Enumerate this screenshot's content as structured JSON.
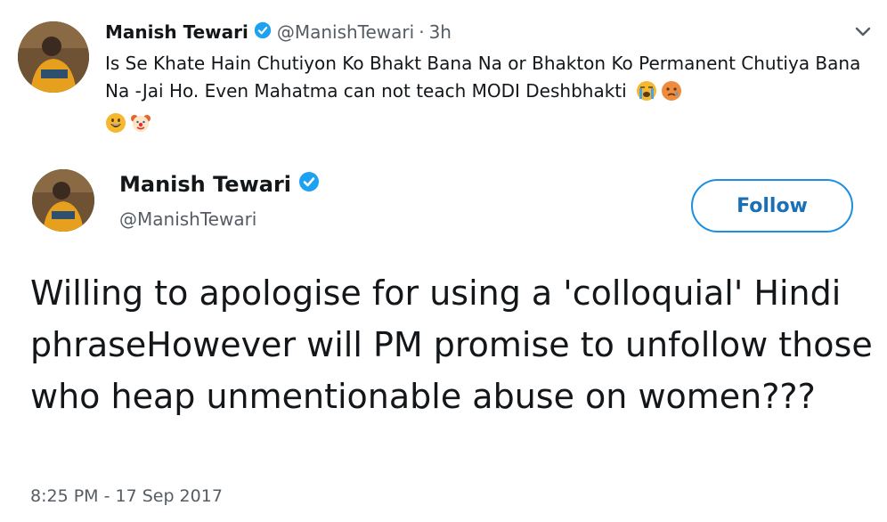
{
  "tweet1": {
    "name": "Manish Tewari",
    "handle": "@ManishTewari",
    "separator": "·",
    "time": "3h",
    "text": "Is Se Khate Hain Chutiyon Ko Bhakt Bana Na or Bhakton Ko Permanent Chutiya Bana Na -Jai Ho. Even Mahatma can not teach MODI Deshbhakti",
    "emojis": [
      "loudly-crying-face",
      "crying-face",
      "grinning-face",
      "clown-face"
    ]
  },
  "tweet2": {
    "name": "Manish Tewari",
    "handle": "@ManishTewari",
    "follow_label": "Follow",
    "text": "Willing to apologise for using a 'colloquial' Hindi phraseHowever will PM promise to unfollow those who heap unmentionable abuse on women???",
    "timestamp": "8:25 PM - 17 Sep 2017"
  },
  "colors": {
    "verified_blue": "#1da1f2",
    "follow_border": "#1d8fe1",
    "follow_text": "#1a6fb5",
    "secondary_text": "#555c63"
  }
}
